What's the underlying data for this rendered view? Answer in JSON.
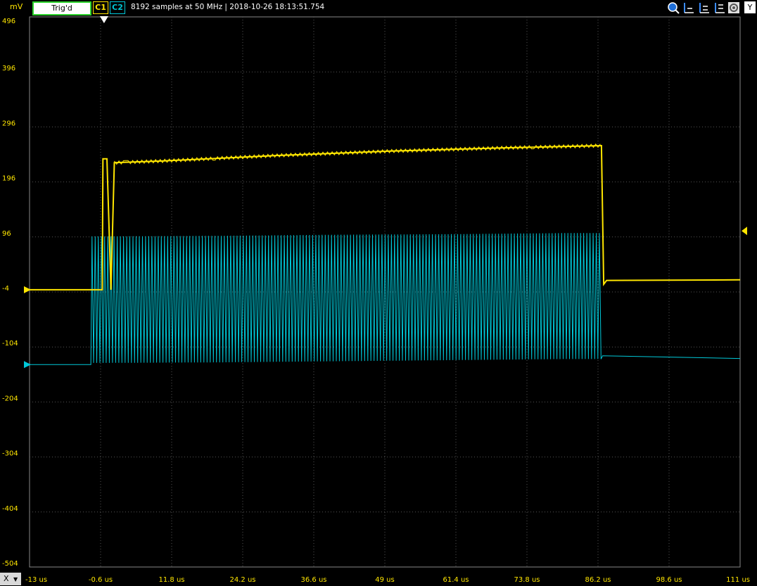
{
  "toolbar": {
    "unit": "mV",
    "trigger_label": "Trig'd",
    "channel1": "C1",
    "channel2": "C2",
    "info": "8192 samples at 50 MHz | 2018-10-26 18:13:51.754",
    "tools": [
      "zoom-icon",
      "bar-graph-icon",
      "bar-graph-icon",
      "bar-graph-icon",
      "settings-icon"
    ],
    "y_button": "Y",
    "x_button": "X"
  },
  "colors": {
    "channel1": "#ffe600",
    "channel2": "#00c8d8",
    "grid": "#555555",
    "background": "#000000"
  },
  "chart_data": {
    "type": "line",
    "ylabel": "mV",
    "ylim": [
      -504,
      496
    ],
    "xlim": [
      -13,
      111
    ],
    "y_ticks": [
      "496",
      "396",
      "296",
      "196",
      "96",
      "-4",
      "-104",
      "-204",
      "-304",
      "-404",
      "-504"
    ],
    "x_ticks": [
      "-13 us",
      "-0.6 us",
      "11.8 us",
      "24.2 us",
      "36.6 us",
      "49 us",
      "61.4 us",
      "73.8 us",
      "86.2 us",
      "98.6 us",
      "111 us"
    ],
    "grid": true,
    "series": [
      {
        "name": "C1",
        "x": [
          -13,
          -1.2,
          -0.3,
          -0.2,
          0.5,
          1.2,
          1.8,
          10,
          30,
          50,
          70,
          86.8,
          87.2,
          87.7,
          111
        ],
        "y": [
          0,
          0,
          0,
          238,
          238,
          0,
          231,
          234,
          244,
          252,
          258,
          262,
          10,
          17,
          18
        ]
      },
      {
        "name": "C2",
        "envelope": true,
        "x": [
          -13,
          -2.3,
          -2.1,
          0,
          20,
          40,
          60,
          80,
          86.8,
          87.0,
          111
        ],
        "high": [
          -136,
          -136,
          97,
          97,
          98,
          100,
          101,
          103,
          103,
          -120,
          -125
        ],
        "low": [
          -136,
          -136,
          -133,
          -133,
          -132,
          -130,
          -128,
          -126,
          -126,
          -120,
          -125
        ]
      }
    ]
  }
}
